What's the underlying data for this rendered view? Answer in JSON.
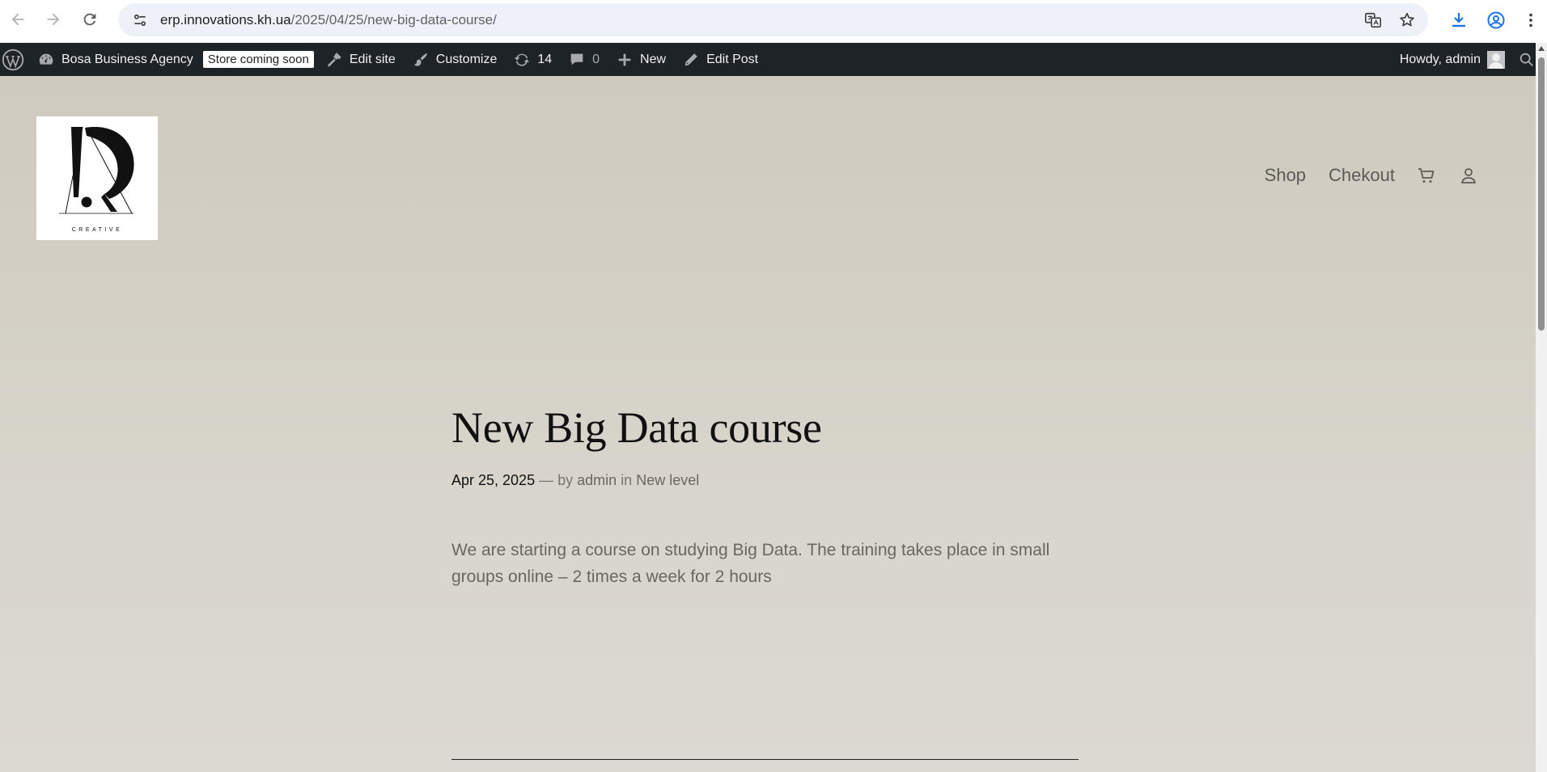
{
  "browser": {
    "url_host": "erp.innovations.kh.ua",
    "url_path": "/2025/04/25/new-big-data-course/"
  },
  "adminbar": {
    "site_name": "Bosa Business Agency",
    "store_badge": "Store coming soon",
    "edit_site": "Edit site",
    "customize": "Customize",
    "updates_count": "14",
    "comments_count": "0",
    "new_label": "New",
    "edit_post": "Edit Post",
    "howdy": "Howdy, admin"
  },
  "site": {
    "logo_text": "CREATIVE",
    "nav": [
      {
        "label": "Shop"
      },
      {
        "label": "Chekout"
      }
    ]
  },
  "post": {
    "title": "New Big Data course",
    "date": "Apr 25, 2025",
    "sep": "—",
    "by": "by",
    "author": "admin",
    "in": "in",
    "category": "New level",
    "body": "We are starting a course on studying Big Data. The training takes place in small groups online – 2 times a week for 2 hours"
  },
  "colors": {
    "adminbar_bg": "#1d2327",
    "page_bg": "#d2cec5",
    "accent_blue": "#1a73e8"
  }
}
